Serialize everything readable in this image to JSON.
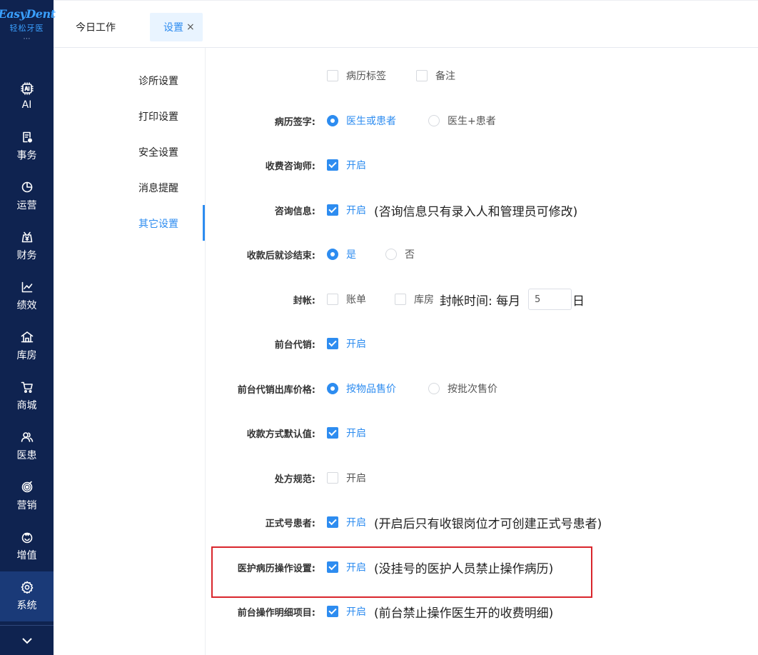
{
  "sidebar": {
    "logo_en": "EasyDent",
    "logo_cn": "轻松牙医",
    "items": [
      {
        "label": "AI",
        "icon": "ai-chip-icon"
      },
      {
        "label": "事务",
        "icon": "task-list-icon"
      },
      {
        "label": "运营",
        "icon": "pie-chart-icon"
      },
      {
        "label": "财务",
        "icon": "money-icon"
      },
      {
        "label": "绩效",
        "icon": "line-chart-icon"
      },
      {
        "label": "库房",
        "icon": "warehouse-icon"
      },
      {
        "label": "商城",
        "icon": "cart-icon"
      },
      {
        "label": "医患",
        "icon": "users-icon"
      },
      {
        "label": "营销",
        "icon": "target-icon"
      },
      {
        "label": "增值",
        "icon": "value-added-icon"
      },
      {
        "label": "系统",
        "icon": "gear-icon"
      }
    ],
    "active_index": 10
  },
  "tabs": {
    "today": "今日工作",
    "settings": "设置",
    "close_glyph": "×"
  },
  "subnav": {
    "items": [
      "诊所设置",
      "打印设置",
      "安全设置",
      "消息提醒",
      "其它设置"
    ],
    "active_index": 4
  },
  "settings": {
    "top": {
      "record_tag": "病历标签",
      "remark": "备注"
    },
    "record_sign": {
      "label": "病历签字:",
      "opt1": "医生或患者",
      "opt2": "医生+患者"
    },
    "fee_consultant": {
      "label": "收费咨询师:",
      "text": "开启"
    },
    "consult_info": {
      "label": "咨询信息:",
      "text": "开启",
      "note": "(咨询信息只有录入人和管理员可修改)"
    },
    "visit_end": {
      "label": "收款后就诊结束:",
      "yes": "是",
      "no": "否"
    },
    "closing": {
      "label": "封帐:",
      "bill": "账单",
      "warehouse": "库房",
      "time_label": "封帐时间:  每月",
      "day_value": "5",
      "day_suffix": "日"
    },
    "front_consign": {
      "label": "前台代销:",
      "text": "开启"
    },
    "consign_price": {
      "label": "前台代销出库价格:",
      "opt1": "按物品售价",
      "opt2": "按批次售价"
    },
    "pay_default": {
      "label": "收款方式默认值:",
      "text": "开启"
    },
    "prescription": {
      "label": "处方规范:",
      "text": "开启"
    },
    "formal_patient": {
      "label": "正式号患者:",
      "text": "开启",
      "note": "(开启后只有收银岗位才可创建正式号患者)"
    },
    "medical_op": {
      "label": "医护病历操作设置:",
      "text": "开启",
      "note": "(没挂号的医护人员禁止操作病历)"
    },
    "front_detail": {
      "label": "前台操作明细项目:",
      "text": "开启",
      "note": "(前台禁止操作医生开的收费明细)"
    }
  },
  "colors": {
    "sidebar": "#0f2350",
    "accent": "#2d8cf0",
    "highlight": "#d9262c"
  }
}
